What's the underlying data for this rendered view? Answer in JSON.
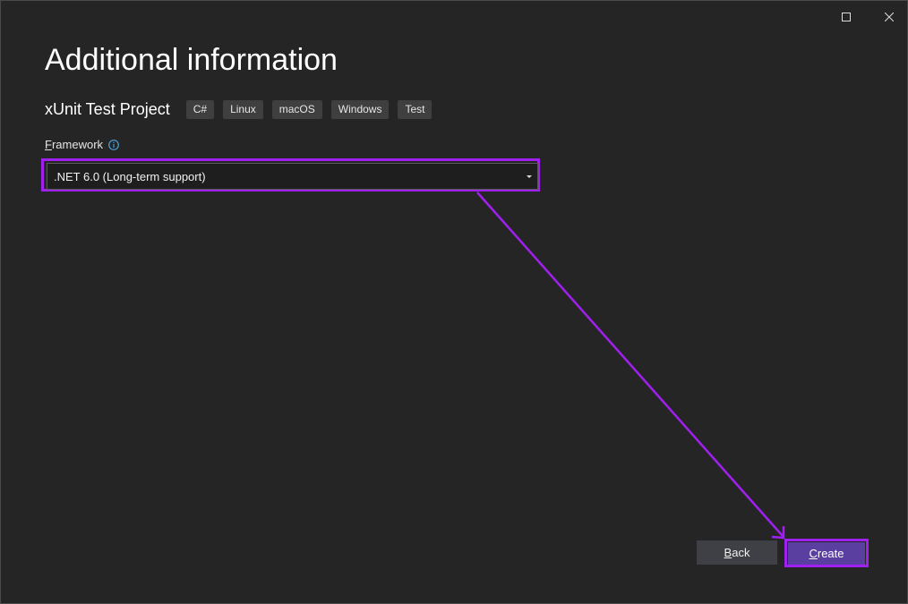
{
  "window_controls": {
    "maximize_icon": "maximize-icon",
    "close_icon": "close-icon"
  },
  "page": {
    "title": "Additional information"
  },
  "template": {
    "name": "xUnit Test Project",
    "tags": [
      "C#",
      "Linux",
      "macOS",
      "Windows",
      "Test"
    ]
  },
  "framework": {
    "label_mnemonic": "F",
    "label_rest": "ramework",
    "info_icon": "info-icon",
    "selected_value": ".NET 6.0 (Long-term support)"
  },
  "buttons": {
    "back_mnemonic": "B",
    "back_rest": "ack",
    "create_mnemonic": "C",
    "create_rest": "reate"
  },
  "colors": {
    "background": "#252526",
    "annotation": "#a020f0",
    "create_button": "#5a3fa0",
    "back_button": "#3f3f46"
  }
}
